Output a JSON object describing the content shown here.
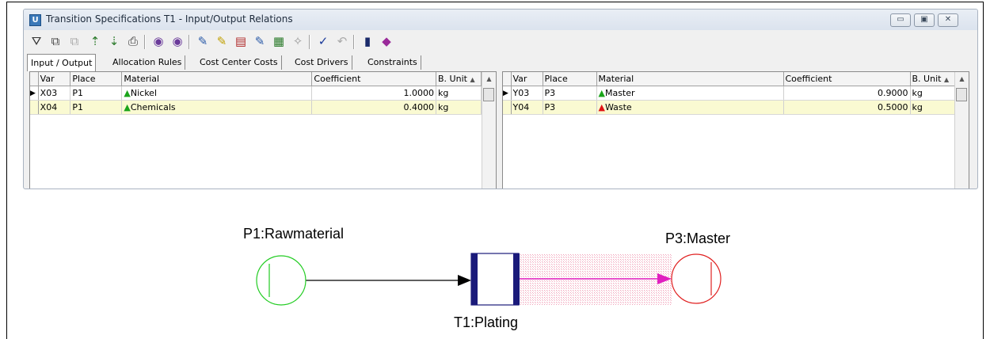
{
  "window": {
    "title": "Transition Specifications T1 - Input/Output Relations",
    "app_icon_letter": "U",
    "buttons": [
      "minimize",
      "restore",
      "close"
    ]
  },
  "toolbar": {
    "icons": [
      "filter-icon",
      "copy-icon",
      "paste-icon",
      "sort-up-icon",
      "sort-down-icon",
      "print-icon",
      "binoculars-icon",
      "binoculars-next-icon",
      "edit-sheet-icon",
      "edit-sheet-2-icon",
      "chart-icon",
      "formula-icon",
      "grid-icon",
      "cleanup-icon",
      "check-icon",
      "undo-icon",
      "save-icon",
      "help-book-icon"
    ]
  },
  "tabs": [
    {
      "label": "Input / Output",
      "active": true
    },
    {
      "label": "Allocation Rules",
      "active": false
    },
    {
      "label": "Cost Center Costs",
      "active": false
    },
    {
      "label": "Cost Drivers",
      "active": false
    },
    {
      "label": "Constraints",
      "active": false
    }
  ],
  "input_table": {
    "columns": [
      "Var",
      "Place",
      "Material",
      "Coefficient",
      "B. Unit"
    ],
    "rows": [
      {
        "var": "X03",
        "place": "P1",
        "material": "Nickel",
        "status": "green",
        "coefficient": "1.0000",
        "unit": "kg"
      },
      {
        "var": "X04",
        "place": "P1",
        "material": "Chemicals",
        "status": "green",
        "coefficient": "0.4000",
        "unit": "kg"
      }
    ]
  },
  "output_table": {
    "columns": [
      "Var",
      "Place",
      "Material",
      "Coefficient",
      "B. Unit"
    ],
    "rows": [
      {
        "var": "Y03",
        "place": "P3",
        "material": "Master",
        "status": "green",
        "coefficient": "0.9000",
        "unit": "kg"
      },
      {
        "var": "Y04",
        "place": "P3",
        "material": "Waste",
        "status": "red",
        "coefficient": "0.5000",
        "unit": "kg"
      }
    ]
  },
  "diagram": {
    "input_place": "P1:Rawmaterial",
    "output_place": "P3:Master",
    "transition": "T1:Plating",
    "colors": {
      "input_place": "#22cc22",
      "output_place": "#e02020",
      "transition": "#1a1a7a",
      "output_arc": "#e020c0",
      "hatch": "#f0a0b8"
    }
  }
}
